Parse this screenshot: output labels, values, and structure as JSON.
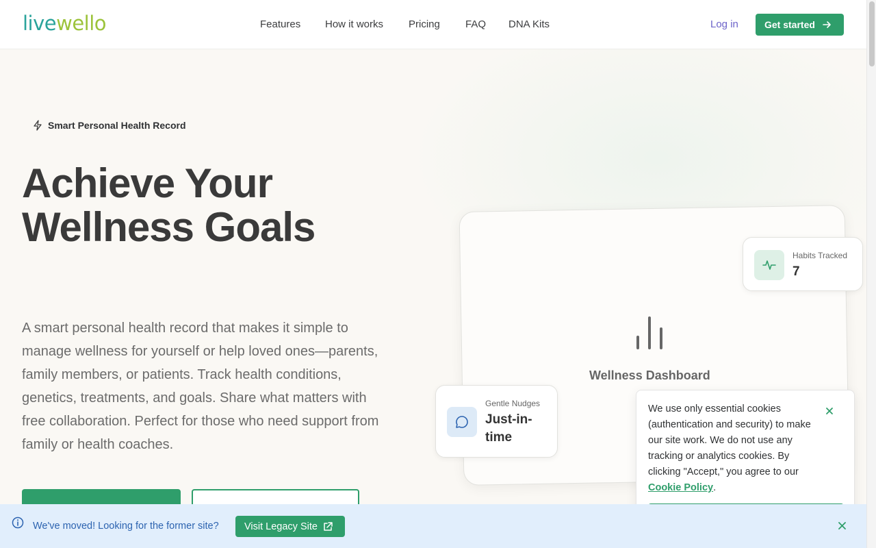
{
  "brand": {
    "logo_part1": "live",
    "logo_part2": "wello"
  },
  "nav": {
    "items": [
      "Features",
      "How it works",
      "Pricing",
      "FAQ",
      "DNA Kits"
    ]
  },
  "header": {
    "login_label": "Log in",
    "cta_label": "Get started"
  },
  "hero": {
    "badge": "Smart Personal Health Record",
    "title_line1": "Achieve Your",
    "title_line2": "Wellness Goals",
    "description": "A smart personal health record that makes it simple to manage wellness for yourself or help loved ones—parents, family members, or patients. Track health conditions, genetics, treatments, and goals. Share what matters with free collaboration. Perfect for those who need support from family or health coaches."
  },
  "dashboard": {
    "label": "Wellness Dashboard",
    "habits": {
      "label": "Habits Tracked",
      "value": "7"
    },
    "nudges": {
      "label": "Gentle Nudges",
      "value": "Just-in-time"
    }
  },
  "cookie": {
    "text": "We use only essential cookies (authentication and security) to make our site work. We do not use any tracking or analytics cookies. By clicking \"Accept,\" you agree to our ",
    "link": "Cookie Policy",
    "suffix": "."
  },
  "banner": {
    "message": "We've moved! Looking for the former site?",
    "button": "Visit Legacy Site"
  },
  "colors": {
    "accent": "#2f9e6b",
    "brand_teal": "#2aa39b",
    "brand_lime": "#9cc33b",
    "link_purple": "#6c63c9",
    "banner_bg": "#e1eefc"
  }
}
